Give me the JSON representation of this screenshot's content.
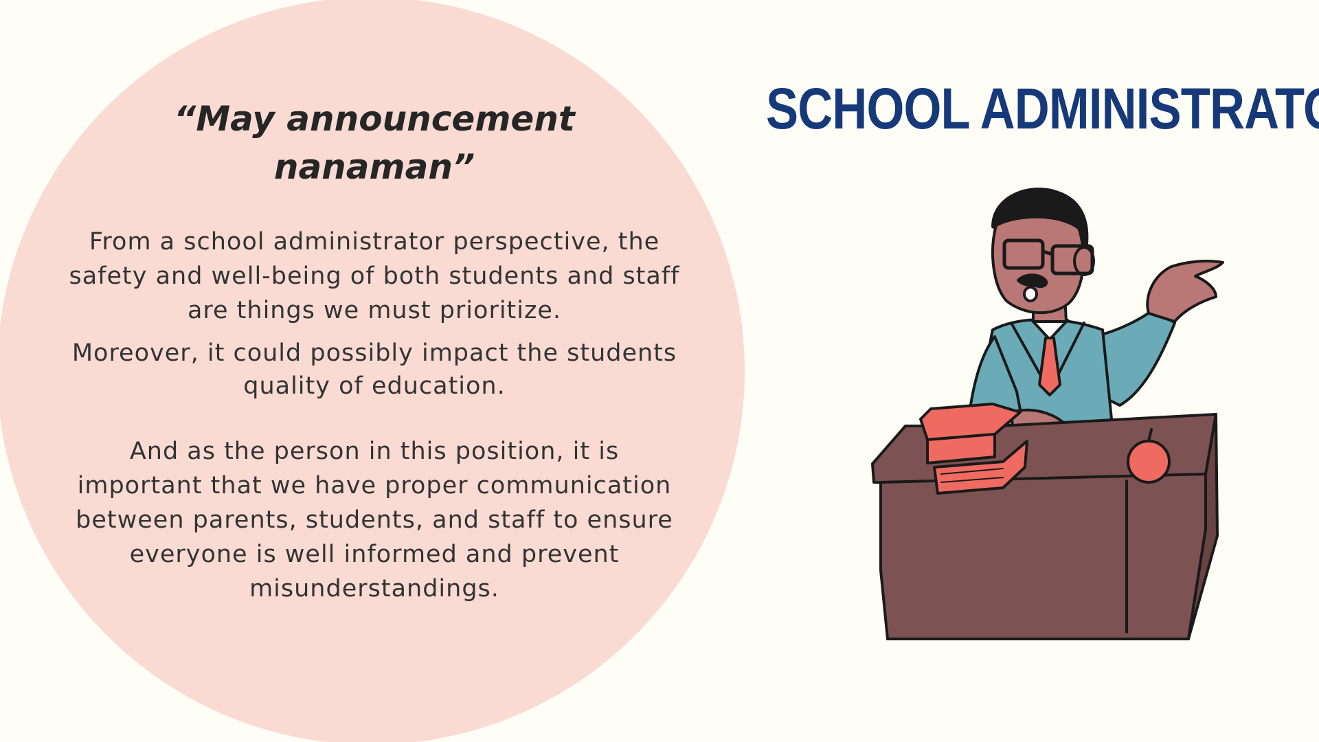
{
  "slide": {
    "title": "SCHOOL ADMINISTRATOR",
    "quote": "“May announcement nanaman”",
    "paragraphs": [
      "From a school administrator perspective, the safety and well-being of both students and staff are things we must prioritize.",
      "Moreover, it could possibly impact the students quality of education.",
      "And as the person in this position, it is important that we have proper communication between parents, students, and staff to ensure everyone is well informed and prevent misunderstandings."
    ]
  },
  "illustration": {
    "subject": "administrator-at-desk",
    "objects": [
      "books",
      "apple",
      "desk",
      "glasses",
      "tie"
    ]
  },
  "colors": {
    "background": "#fefdf6",
    "circle": "#fadbd3",
    "title": "#16397a",
    "text": "#333333",
    "desk": "#7d5252",
    "sweater": "#6aabb7",
    "skin": "#b97776",
    "books": "#ef6b62"
  }
}
